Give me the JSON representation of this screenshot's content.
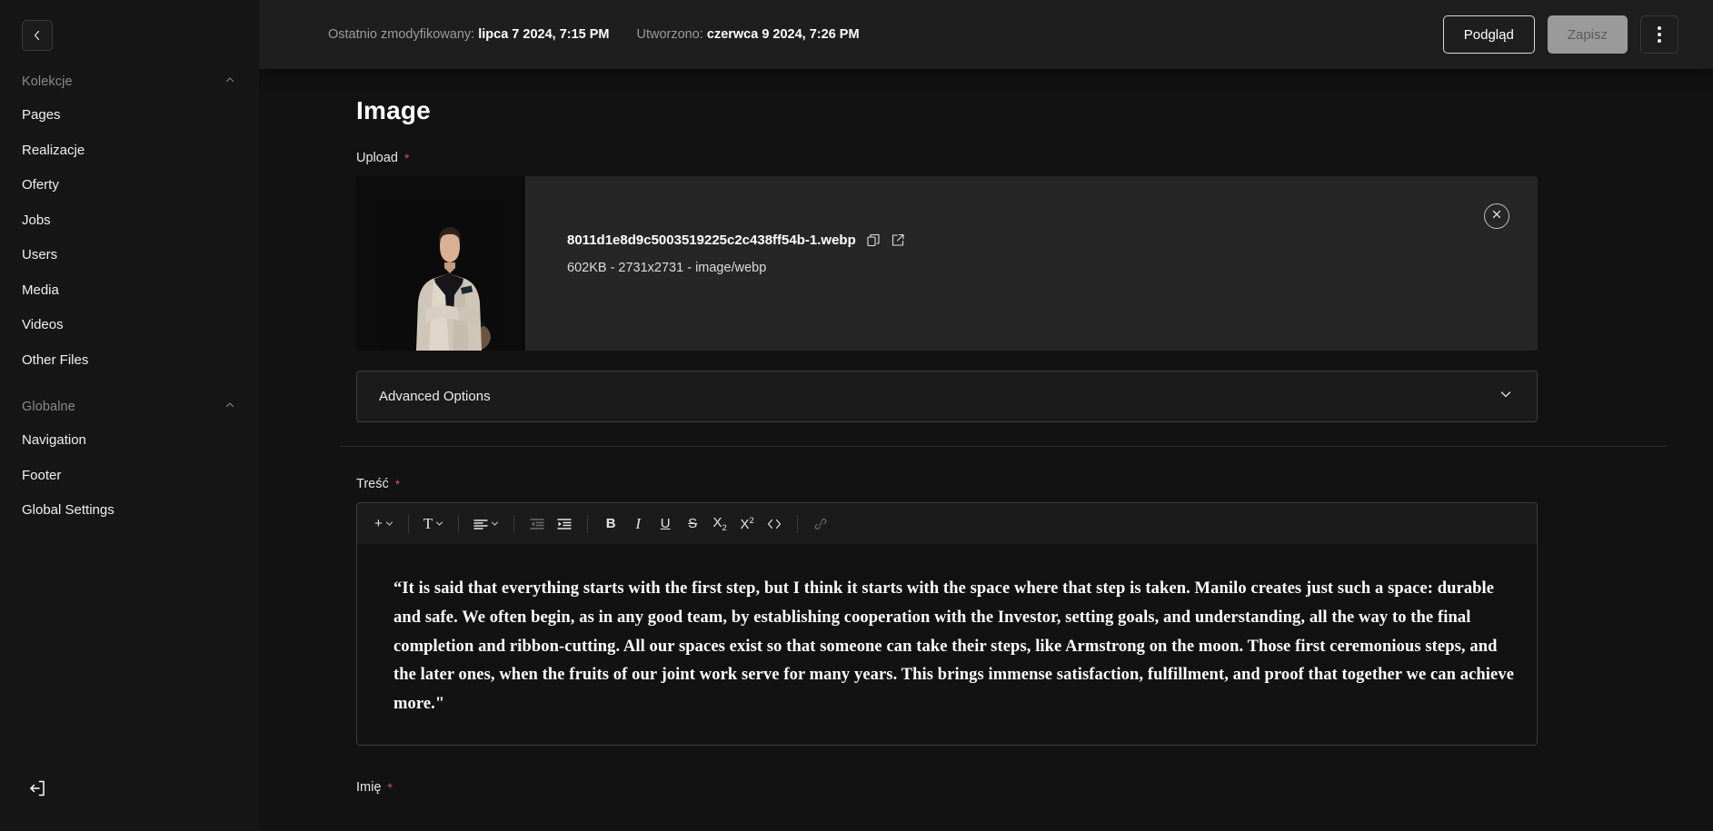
{
  "sidebar": {
    "collapse_icon": "chevron-left-icon",
    "sections": [
      {
        "label": "Kolekcje",
        "chevron": "chevron-up-icon",
        "items": [
          {
            "label": "Pages"
          },
          {
            "label": "Realizacje"
          },
          {
            "label": "Oferty"
          },
          {
            "label": "Jobs"
          },
          {
            "label": "Users"
          },
          {
            "label": "Media"
          },
          {
            "label": "Videos"
          },
          {
            "label": "Other Files"
          }
        ]
      },
      {
        "label": "Globalne",
        "chevron": "chevron-up-icon",
        "items": [
          {
            "label": "Navigation"
          },
          {
            "label": "Footer"
          },
          {
            "label": "Global Settings"
          }
        ]
      }
    ],
    "logout_icon": "logout-icon"
  },
  "topbar": {
    "last_modified_label": "Ostatnio zmodyfikowany:",
    "last_modified_value": "lipca 7 2024, 7:15 PM",
    "created_label": "Utworzono:",
    "created_value": "czerwca 9 2024, 7:26 PM",
    "preview_button": "Podgląd",
    "save_button": "Zapisz",
    "more_icon": "more-vertical-icon"
  },
  "form": {
    "title": "Image",
    "upload": {
      "label": "Upload",
      "required_marker": "*",
      "file_name": "8011d1e8d9c5003519225c2c438ff54b-1.webp",
      "file_meta": "602KB - 2731x2731 - image/webp",
      "copy_icon": "copy-icon",
      "edit_icon": "edit-external-icon",
      "remove_icon": "close-circle-icon",
      "thumbnail_alt": "portrait-photo"
    },
    "advanced_options": {
      "label": "Advanced Options",
      "chevron": "chevron-down-icon"
    },
    "content_field": {
      "label": "Treść",
      "required_marker": "*",
      "toolbar": [
        {
          "name": "insert-block-button",
          "glyph": "+",
          "has_chevron": true,
          "dim": false
        },
        {
          "name": "text-style-button",
          "glyph": "T",
          "has_chevron": true,
          "dim": false
        },
        {
          "name": "align-button",
          "glyph": "align",
          "has_chevron": true,
          "dim": false
        },
        {
          "name": "outdent-button",
          "glyph": "outdent",
          "has_chevron": false,
          "dim": true
        },
        {
          "name": "indent-button",
          "glyph": "indent",
          "has_chevron": false,
          "dim": false
        },
        {
          "name": "bold-button",
          "glyph": "B",
          "has_chevron": false,
          "dim": false
        },
        {
          "name": "italic-button",
          "glyph": "I",
          "has_chevron": false,
          "dim": false
        },
        {
          "name": "underline-button",
          "glyph": "U",
          "has_chevron": false,
          "dim": false
        },
        {
          "name": "strikethrough-button",
          "glyph": "S",
          "has_chevron": false,
          "dim": false
        },
        {
          "name": "subscript-button",
          "glyph": "X2sub",
          "has_chevron": false,
          "dim": false
        },
        {
          "name": "superscript-button",
          "glyph": "X2sup",
          "has_chevron": false,
          "dim": false
        },
        {
          "name": "code-button",
          "glyph": "<>",
          "has_chevron": false,
          "dim": false
        },
        {
          "name": "link-button",
          "glyph": "link",
          "has_chevron": false,
          "dim": true
        }
      ],
      "value": "“It is said that everything starts with the first step, but I think it starts with the space where that step is taken. Manilo creates just such a space: durable and safe. We often begin, as in any good team, by establishing cooperation with the Investor, setting goals, and understanding, all the way to the final completion and ribbon-cutting. All our spaces exist so that someone can take their steps, like Armstrong on the moon. Those first ceremonious steps, and the later ones, when the fruits of our joint work serve for many years. This brings immense satisfaction, fulfillment, and proof that together we can achieve more.\""
    },
    "name_field": {
      "label": "Imię",
      "required_marker": "*"
    }
  },
  "colors": {
    "page_bg": "#121212",
    "sidebar_bg": "#161616",
    "topbar_bg": "#1e1e1e",
    "card_bg": "#262626",
    "required": "#c15b5b",
    "save_disabled": "#9a9a9a"
  }
}
